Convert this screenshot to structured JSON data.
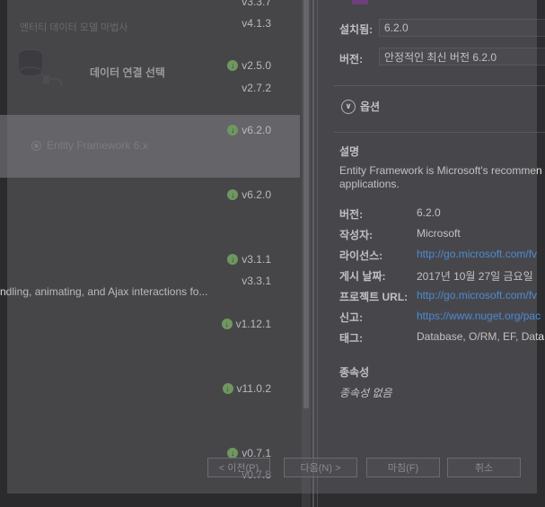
{
  "wizard": {
    "subtitle": "엔터티 데이터 모델 마법사",
    "title": "데이터 연결 선택",
    "radio_label": "Entity Framework 6.x",
    "buttons": {
      "prev": "< 이전(P)",
      "next": "다음(N) >",
      "finish": "마침(F)",
      "cancel": "취소"
    }
  },
  "package_list": {
    "versions": [
      {
        "text": "v3.3.7",
        "download": false
      },
      {
        "text": "v4.1.3",
        "download": false
      },
      {
        "text": "v2.5.0",
        "download": true
      },
      {
        "text": "v2.7.2",
        "download": false
      },
      {
        "text": "v6.2.0",
        "download": true
      },
      {
        "text": "v6.2.0",
        "download": true
      },
      {
        "text": "v3.1.1",
        "download": true
      },
      {
        "text": "v3.3.1",
        "download": false
      },
      {
        "text": "v1.12.1",
        "download": true
      },
      {
        "text": "v11.0.2",
        "download": true
      },
      {
        "text": "v0.7.1",
        "download": true
      },
      {
        "text": "v0.7.8",
        "download": false
      }
    ],
    "description_fragment": "ndling, animating, and Ajax interactions fo..."
  },
  "details": {
    "installed_label": "설치됨:",
    "installed_value": "6.2.0",
    "version_label": "버전:",
    "version_value": "안정적인 최신 버전 6.2.0",
    "options_label": "옵션",
    "description_title": "설명",
    "description_line1": "Entity Framework is Microsoft's recommen",
    "description_line2": "applications.",
    "meta": {
      "version_label": "버전:",
      "version_value": "6.2.0",
      "author_label": "작성자:",
      "author_value": "Microsoft",
      "license_label": "라이선스:",
      "license_value": "http://go.microsoft.com/fv",
      "date_label": "게시 날짜:",
      "date_value": "2017년 10월 27일 금요일",
      "project_label": "프로젝트 URL:",
      "project_value": "http://go.microsoft.com/fv",
      "report_label": "신고:",
      "report_value": "https://www.nuget.org/pac",
      "tags_label": "태그:",
      "tags_value": "Database, O/RM, EF, Data,"
    },
    "dependencies_title": "종속성",
    "dependencies_none": "종속성 없음"
  },
  "colors": {
    "accent": "#68217a",
    "link": "#3794ff",
    "download": "#6aa84f"
  }
}
